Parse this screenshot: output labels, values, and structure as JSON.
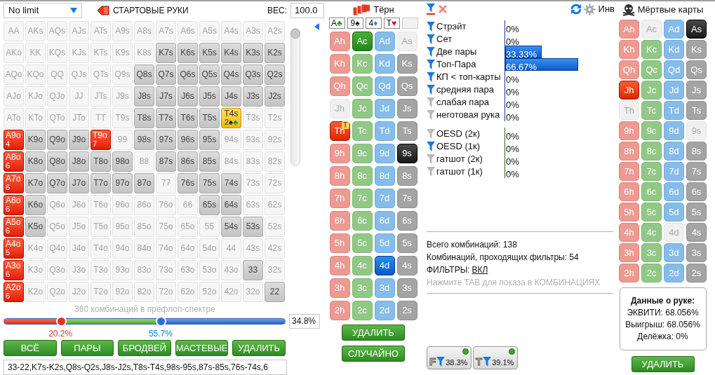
{
  "header": {
    "game_select": "No limit",
    "title": "СТАРТОВЫЕ РУКИ",
    "weight_label": "ВЕС:",
    "weight_value": "100.0"
  },
  "grid": [
    [
      {
        "hand": "AA",
        "kind": "off"
      },
      {
        "hand": "AKs",
        "kind": "off"
      },
      {
        "hand": "AQs",
        "kind": "off"
      },
      {
        "hand": "AJs",
        "kind": "off"
      },
      {
        "hand": "ATs",
        "kind": "off"
      },
      {
        "hand": "A9s",
        "kind": "off"
      },
      {
        "hand": "A8s",
        "kind": "off"
      },
      {
        "hand": "A7s",
        "kind": "off"
      },
      {
        "hand": "A6s",
        "kind": "off"
      },
      {
        "hand": "A5s",
        "kind": "off"
      },
      {
        "hand": "A4s",
        "kind": "off"
      },
      {
        "hand": "A3s",
        "kind": "off"
      },
      {
        "hand": "A2s",
        "kind": "off"
      }
    ],
    [
      {
        "hand": "AKo",
        "kind": "off"
      },
      {
        "hand": "KK",
        "kind": "off"
      },
      {
        "hand": "KQs",
        "kind": "off"
      },
      {
        "hand": "KJs",
        "kind": "off"
      },
      {
        "hand": "KTs",
        "kind": "off"
      },
      {
        "hand": "K9s",
        "kind": "off"
      },
      {
        "hand": "K8s",
        "kind": "off"
      },
      {
        "hand": "K7s",
        "kind": "range"
      },
      {
        "hand": "K6s",
        "kind": "range"
      },
      {
        "hand": "K5s",
        "kind": "range"
      },
      {
        "hand": "K4s",
        "kind": "range"
      },
      {
        "hand": "K3s",
        "kind": "range"
      },
      {
        "hand": "K2s",
        "kind": "range"
      }
    ],
    [
      {
        "hand": "AQo",
        "kind": "off"
      },
      {
        "hand": "KQo",
        "kind": "off"
      },
      {
        "hand": "QQ",
        "kind": "off"
      },
      {
        "hand": "QJs",
        "kind": "off"
      },
      {
        "hand": "QTs",
        "kind": "off"
      },
      {
        "hand": "Q9s",
        "kind": "off"
      },
      {
        "hand": "Q8s",
        "kind": "range"
      },
      {
        "hand": "Q7s",
        "kind": "range"
      },
      {
        "hand": "Q6s",
        "kind": "range"
      },
      {
        "hand": "Q5s",
        "kind": "range"
      },
      {
        "hand": "Q4s",
        "kind": "range"
      },
      {
        "hand": "Q3s",
        "kind": "range"
      },
      {
        "hand": "Q2s",
        "kind": "range"
      }
    ],
    [
      {
        "hand": "AJo",
        "kind": "off"
      },
      {
        "hand": "KJo",
        "kind": "off"
      },
      {
        "hand": "QJo",
        "kind": "off"
      },
      {
        "hand": "JJ",
        "kind": "off"
      },
      {
        "hand": "JTs",
        "kind": "off"
      },
      {
        "hand": "J9s",
        "kind": "off"
      },
      {
        "hand": "J8s",
        "kind": "range"
      },
      {
        "hand": "J7s",
        "kind": "range"
      },
      {
        "hand": "J6s",
        "kind": "range"
      },
      {
        "hand": "J5s",
        "kind": "range"
      },
      {
        "hand": "J4s",
        "kind": "range"
      },
      {
        "hand": "J3s",
        "kind": "range"
      },
      {
        "hand": "J2s",
        "kind": "range"
      }
    ],
    [
      {
        "hand": "ATo",
        "kind": "off"
      },
      {
        "hand": "KTo",
        "kind": "off"
      },
      {
        "hand": "QTo",
        "kind": "off"
      },
      {
        "hand": "JTo",
        "kind": "off"
      },
      {
        "hand": "TT",
        "kind": "off"
      },
      {
        "hand": "T9s",
        "kind": "off"
      },
      {
        "hand": "T8s",
        "kind": "range"
      },
      {
        "hand": "T7s",
        "kind": "range"
      },
      {
        "hand": "T6s",
        "kind": "range"
      },
      {
        "hand": "T5s",
        "kind": "range"
      },
      {
        "hand": "T4s",
        "kind": "highlight",
        "count": "2",
        "suits": [
          {
            "symbol": "♠",
            "color": "#111111"
          },
          {
            "symbol": "♣",
            "color": "#2e9a22"
          }
        ]
      },
      {
        "hand": "T3s",
        "kind": "off"
      },
      {
        "hand": "T2s",
        "kind": "off"
      }
    ],
    [
      {
        "hand": "A9o",
        "kind": "weighted",
        "count": "4"
      },
      {
        "hand": "K9o",
        "kind": "range"
      },
      {
        "hand": "Q9o",
        "kind": "range"
      },
      {
        "hand": "J9o",
        "kind": "range"
      },
      {
        "hand": "T9o",
        "kind": "weighted",
        "count": "7"
      },
      {
        "hand": "99",
        "kind": "off"
      },
      {
        "hand": "98s",
        "kind": "range"
      },
      {
        "hand": "97s",
        "kind": "range"
      },
      {
        "hand": "96s",
        "kind": "range"
      },
      {
        "hand": "95s",
        "kind": "range"
      },
      {
        "hand": "94s",
        "kind": "off"
      },
      {
        "hand": "93s",
        "kind": "off"
      },
      {
        "hand": "92s",
        "kind": "off"
      }
    ],
    [
      {
        "hand": "A8o",
        "kind": "weighted",
        "count": "6"
      },
      {
        "hand": "K8o",
        "kind": "range"
      },
      {
        "hand": "Q8o",
        "kind": "range"
      },
      {
        "hand": "J8o",
        "kind": "range"
      },
      {
        "hand": "T8o",
        "kind": "range"
      },
      {
        "hand": "98o",
        "kind": "range"
      },
      {
        "hand": "88",
        "kind": "off"
      },
      {
        "hand": "87s",
        "kind": "range"
      },
      {
        "hand": "86s",
        "kind": "range"
      },
      {
        "hand": "85s",
        "kind": "range"
      },
      {
        "hand": "84s",
        "kind": "off"
      },
      {
        "hand": "83s",
        "kind": "off"
      },
      {
        "hand": "82s",
        "kind": "off"
      }
    ],
    [
      {
        "hand": "A7o",
        "kind": "weighted",
        "count": "6"
      },
      {
        "hand": "K7o",
        "kind": "range"
      },
      {
        "hand": "Q7o",
        "kind": "range"
      },
      {
        "hand": "J7o",
        "kind": "range"
      },
      {
        "hand": "T7o",
        "kind": "range"
      },
      {
        "hand": "97o",
        "kind": "range"
      },
      {
        "hand": "87o",
        "kind": "range"
      },
      {
        "hand": "77",
        "kind": "off"
      },
      {
        "hand": "76s",
        "kind": "range"
      },
      {
        "hand": "75s",
        "kind": "range"
      },
      {
        "hand": "74s",
        "kind": "range"
      },
      {
        "hand": "73s",
        "kind": "off"
      },
      {
        "hand": "72s",
        "kind": "off"
      }
    ],
    [
      {
        "hand": "A6o",
        "kind": "weighted",
        "count": "6"
      },
      {
        "hand": "K6o",
        "kind": "range"
      },
      {
        "hand": "Q6o",
        "kind": "off"
      },
      {
        "hand": "J6o",
        "kind": "off"
      },
      {
        "hand": "T6o",
        "kind": "off"
      },
      {
        "hand": "96o",
        "kind": "off"
      },
      {
        "hand": "86o",
        "kind": "off"
      },
      {
        "hand": "76o",
        "kind": "off"
      },
      {
        "hand": "66",
        "kind": "off"
      },
      {
        "hand": "65s",
        "kind": "range"
      },
      {
        "hand": "64s",
        "kind": "range"
      },
      {
        "hand": "63s",
        "kind": "off"
      },
      {
        "hand": "62s",
        "kind": "off"
      }
    ],
    [
      {
        "hand": "A5o",
        "kind": "weighted",
        "count": "6"
      },
      {
        "hand": "K5o",
        "kind": "range"
      },
      {
        "hand": "Q5o",
        "kind": "off"
      },
      {
        "hand": "J5o",
        "kind": "off"
      },
      {
        "hand": "T5o",
        "kind": "off"
      },
      {
        "hand": "95o",
        "kind": "off"
      },
      {
        "hand": "85o",
        "kind": "off"
      },
      {
        "hand": "75o",
        "kind": "off"
      },
      {
        "hand": "65o",
        "kind": "off"
      },
      {
        "hand": "55",
        "kind": "off"
      },
      {
        "hand": "54s",
        "kind": "range"
      },
      {
        "hand": "53s",
        "kind": "range"
      },
      {
        "hand": "52s",
        "kind": "off"
      }
    ],
    [
      {
        "hand": "A4o",
        "kind": "weighted",
        "count": "5"
      },
      {
        "hand": "K4o",
        "kind": "off"
      },
      {
        "hand": "Q4o",
        "kind": "off"
      },
      {
        "hand": "J4o",
        "kind": "off"
      },
      {
        "hand": "T4o",
        "kind": "off"
      },
      {
        "hand": "94o",
        "kind": "off"
      },
      {
        "hand": "84o",
        "kind": "off"
      },
      {
        "hand": "74o",
        "kind": "off"
      },
      {
        "hand": "64o",
        "kind": "off"
      },
      {
        "hand": "54o",
        "kind": "off"
      },
      {
        "hand": "44",
        "kind": "off"
      },
      {
        "hand": "43s",
        "kind": "off"
      },
      {
        "hand": "42s",
        "kind": "off"
      }
    ],
    [
      {
        "hand": "A3o",
        "kind": "weighted",
        "count": "6"
      },
      {
        "hand": "K3o",
        "kind": "off"
      },
      {
        "hand": "Q3o",
        "kind": "off"
      },
      {
        "hand": "J3o",
        "kind": "off"
      },
      {
        "hand": "T3o",
        "kind": "off"
      },
      {
        "hand": "93o",
        "kind": "off"
      },
      {
        "hand": "83o",
        "kind": "off"
      },
      {
        "hand": "73o",
        "kind": "off"
      },
      {
        "hand": "63o",
        "kind": "off"
      },
      {
        "hand": "53o",
        "kind": "off"
      },
      {
        "hand": "43o",
        "kind": "off"
      },
      {
        "hand": "33",
        "kind": "range"
      },
      {
        "hand": "32s",
        "kind": "off"
      }
    ],
    [
      {
        "hand": "A2o",
        "kind": "weighted",
        "count": "6"
      },
      {
        "hand": "K2o",
        "kind": "off"
      },
      {
        "hand": "Q2o",
        "kind": "off"
      },
      {
        "hand": "J2o",
        "kind": "off"
      },
      {
        "hand": "T2o",
        "kind": "off"
      },
      {
        "hand": "92o",
        "kind": "off"
      },
      {
        "hand": "82o",
        "kind": "off"
      },
      {
        "hand": "72o",
        "kind": "off"
      },
      {
        "hand": "62o",
        "kind": "off"
      },
      {
        "hand": "52o",
        "kind": "off"
      },
      {
        "hand": "42o",
        "kind": "off"
      },
      {
        "hand": "32o",
        "kind": "off"
      },
      {
        "hand": "22",
        "kind": "range"
      }
    ]
  ],
  "weight_slider": {
    "level": 1
  },
  "range_slider": {
    "caption": "360 комбинаций в префлоп-спектре",
    "low": {
      "level": 0.202,
      "label": "20.2%"
    },
    "high": {
      "level": 0.557,
      "label": "55.7%"
    },
    "value": "34.8%"
  },
  "range_buttons": [
    "ВСЁ",
    "ПАРЫ",
    "БРОДВЕЙ",
    "МАСТЕВЫЕ",
    "УДАЛИТЬ"
  ],
  "range_text": "33-22,K7s-K2s,Q8s-Q2s,J8s-J2s,T8s-T4s,98s-95s,87s-85s,76s-74s,6",
  "turn": {
    "title": "Тёрн",
    "board": [
      {
        "kind": "card",
        "rank": "A",
        "suit": "♣",
        "color": "#2e9a22"
      },
      {
        "kind": "card",
        "rank": "9",
        "suit": "♠",
        "color": "#111111"
      },
      {
        "kind": "card",
        "rank": "4",
        "suit": "♦",
        "color": "#1e90e8"
      },
      {
        "kind": "card",
        "rank": "T",
        "suit": "♥",
        "color": "#e01010"
      },
      {
        "kind": "empty"
      }
    ],
    "cards": [
      [
        {
          "label": "Ah",
          "selected": false,
          "dead": false
        },
        {
          "label": "Ac",
          "selected": true,
          "dead": false
        },
        {
          "label": "Ad",
          "selected": false,
          "dead": false
        },
        {
          "label": "As",
          "selected": false,
          "dead": true
        }
      ],
      [
        {
          "label": "Kh",
          "selected": false,
          "dead": false
        },
        {
          "label": "Kc",
          "selected": false,
          "dead": false
        },
        {
          "label": "Kd",
          "selected": false,
          "dead": false
        },
        {
          "label": "Ks",
          "selected": false,
          "dead": false
        }
      ],
      [
        {
          "label": "Qh",
          "selected": false,
          "dead": false
        },
        {
          "label": "Qc",
          "selected": false,
          "dead": false
        },
        {
          "label": "Qd",
          "selected": false,
          "dead": false
        },
        {
          "label": "Qs",
          "selected": false,
          "dead": false
        }
      ],
      [
        {
          "label": "Jh",
          "selected": false,
          "dead": true
        },
        {
          "label": "Jc",
          "selected": false,
          "dead": false
        },
        {
          "label": "Jd",
          "selected": false,
          "dead": false
        },
        {
          "label": "Js",
          "selected": false,
          "dead": false
        }
      ],
      [
        {
          "label": "Th",
          "selected": true,
          "dead": false,
          "badge": "T"
        },
        {
          "label": "Tc",
          "selected": false,
          "dead": false
        },
        {
          "label": "Td",
          "selected": false,
          "dead": false
        },
        {
          "label": "Ts",
          "selected": false,
          "dead": false
        }
      ],
      [
        {
          "label": "9h",
          "selected": false,
          "dead": false
        },
        {
          "label": "9c",
          "selected": false,
          "dead": false
        },
        {
          "label": "9d",
          "selected": false,
          "dead": false
        },
        {
          "label": "9s",
          "selected": true,
          "dead": false
        }
      ],
      [
        {
          "label": "8h",
          "selected": false,
          "dead": false
        },
        {
          "label": "8c",
          "selected": false,
          "dead": false
        },
        {
          "label": "8d",
          "selected": false,
          "dead": false
        },
        {
          "label": "8s",
          "selected": false,
          "dead": false
        }
      ],
      [
        {
          "label": "7h",
          "selected": false,
          "dead": false
        },
        {
          "label": "7c",
          "selected": false,
          "dead": false
        },
        {
          "label": "7d",
          "selected": false,
          "dead": false
        },
        {
          "label": "7s",
          "selected": false,
          "dead": false
        }
      ],
      [
        {
          "label": "6h",
          "selected": false,
          "dead": false
        },
        {
          "label": "6c",
          "selected": false,
          "dead": false
        },
        {
          "label": "6d",
          "selected": false,
          "dead": false
        },
        {
          "label": "6s",
          "selected": false,
          "dead": false
        }
      ],
      [
        {
          "label": "5h",
          "selected": false,
          "dead": false
        },
        {
          "label": "5c",
          "selected": false,
          "dead": false
        },
        {
          "label": "5d",
          "selected": false,
          "dead": false
        },
        {
          "label": "5s",
          "selected": false,
          "dead": false
        }
      ],
      [
        {
          "label": "4h",
          "selected": false,
          "dead": false
        },
        {
          "label": "4c",
          "selected": false,
          "dead": false
        },
        {
          "label": "4d",
          "selected": true,
          "dead": false
        },
        {
          "label": "4s",
          "selected": false,
          "dead": false
        }
      ],
      [
        {
          "label": "3h",
          "selected": false,
          "dead": false
        },
        {
          "label": "3c",
          "selected": false,
          "dead": false
        },
        {
          "label": "3d",
          "selected": false,
          "dead": false
        },
        {
          "label": "3s",
          "selected": false,
          "dead": false
        }
      ],
      [
        {
          "label": "2h",
          "selected": false,
          "dead": false
        },
        {
          "label": "2c",
          "selected": false,
          "dead": false
        },
        {
          "label": "2d",
          "selected": false,
          "dead": false
        },
        {
          "label": "2s",
          "selected": false,
          "dead": false
        }
      ]
    ],
    "buttons": [
      "УДАЛИТЬ",
      "СЛУЧАЙНО"
    ]
  },
  "filters": {
    "invert_label": "Инв",
    "groups": [
      {
        "kind": "made",
        "items": [
          {
            "label": "Стрэйт",
            "on": true,
            "value": "0%"
          },
          {
            "label": "Сет",
            "on": true,
            "value": "0%"
          },
          {
            "label": "Две пары",
            "on": true,
            "value": "33.33%",
            "level": 0.3333
          },
          {
            "label": "Топ-Пара",
            "on": true,
            "value": "66.67%",
            "level": 0.6667
          },
          {
            "label": "КП < топ-карты",
            "on": true,
            "value": "0%"
          },
          {
            "label": "средняя пара",
            "on": true,
            "value": "0%"
          },
          {
            "label": "слабая пара",
            "on": false,
            "value": "0%"
          },
          {
            "label": "неготовая рука",
            "on": false,
            "value": "0%"
          }
        ]
      },
      {
        "kind": "draw",
        "items": [
          {
            "label": "OESD (2к)",
            "on": false,
            "value": "0%"
          },
          {
            "label": "OESD (1к)",
            "on": true,
            "value": "0%"
          },
          {
            "label": "гатшот (2к)",
            "on": false,
            "value": "0%"
          },
          {
            "label": "гатшот (1к)",
            "on": false,
            "value": "0%"
          }
        ]
      }
    ],
    "stats": [
      "Всего комбинаций: 138",
      "Комбинаций, проходящих фильтры: 54"
    ],
    "filters_state": {
      "label": "ФИЛЬТРЫ:",
      "link": "ВКЛ"
    },
    "hint": "Нажмите TAB для показа в КОМБИНАЦИЯХ",
    "toggles": [
      {
        "letter": "F",
        "value": "38.3%",
        "on": true
      },
      {
        "letter": "T",
        "value": "39.1%",
        "on": true
      }
    ]
  },
  "dead": {
    "title": "Мёртвые карты",
    "cards": [
      [
        {
          "label": "Ah",
          "selected": false,
          "dead": false
        },
        {
          "label": "Ac",
          "selected": false,
          "dead": true
        },
        {
          "label": "Ad",
          "selected": false,
          "dead": false
        },
        {
          "label": "As",
          "selected": true,
          "dead": false
        }
      ],
      [
        {
          "label": "Kh",
          "selected": false,
          "dead": false
        },
        {
          "label": "Kc",
          "selected": false,
          "dead": false
        },
        {
          "label": "Kd",
          "selected": false,
          "dead": false
        },
        {
          "label": "Ks",
          "selected": false,
          "dead": false
        }
      ],
      [
        {
          "label": "Qh",
          "selected": false,
          "dead": false
        },
        {
          "label": "Qc",
          "selected": false,
          "dead": false
        },
        {
          "label": "Qd",
          "selected": false,
          "dead": false
        },
        {
          "label": "Qs",
          "selected": false,
          "dead": false
        }
      ],
      [
        {
          "label": "Jh",
          "selected": true,
          "dead": false
        },
        {
          "label": "Jc",
          "selected": false,
          "dead": false
        },
        {
          "label": "Jd",
          "selected": false,
          "dead": false
        },
        {
          "label": "Js",
          "selected": false,
          "dead": false
        }
      ],
      [
        {
          "label": "Th",
          "selected": false,
          "dead": true
        },
        {
          "label": "Tc",
          "selected": false,
          "dead": false
        },
        {
          "label": "Td",
          "selected": false,
          "dead": false
        },
        {
          "label": "Ts",
          "selected": false,
          "dead": false
        }
      ],
      [
        {
          "label": "9h",
          "selected": false,
          "dead": false
        },
        {
          "label": "9c",
          "selected": false,
          "dead": false
        },
        {
          "label": "9d",
          "selected": false,
          "dead": false
        },
        {
          "label": "9s",
          "selected": false,
          "dead": true
        }
      ],
      [
        {
          "label": "8h",
          "selected": false,
          "dead": false
        },
        {
          "label": "8c",
          "selected": false,
          "dead": false
        },
        {
          "label": "8d",
          "selected": false,
          "dead": false
        },
        {
          "label": "8s",
          "selected": false,
          "dead": false
        }
      ],
      [
        {
          "label": "7h",
          "selected": false,
          "dead": false
        },
        {
          "label": "7c",
          "selected": false,
          "dead": false
        },
        {
          "label": "7d",
          "selected": false,
          "dead": false
        },
        {
          "label": "7s",
          "selected": false,
          "dead": false
        }
      ],
      [
        {
          "label": "6h",
          "selected": false,
          "dead": false
        },
        {
          "label": "6c",
          "selected": false,
          "dead": false
        },
        {
          "label": "6d",
          "selected": false,
          "dead": false
        },
        {
          "label": "6s",
          "selected": false,
          "dead": false
        }
      ],
      [
        {
          "label": "5h",
          "selected": false,
          "dead": false
        },
        {
          "label": "5c",
          "selected": false,
          "dead": false
        },
        {
          "label": "5d",
          "selected": false,
          "dead": false
        },
        {
          "label": "5s",
          "selected": false,
          "dead": false
        }
      ],
      [
        {
          "label": "4h",
          "selected": false,
          "dead": false
        },
        {
          "label": "4c",
          "selected": false,
          "dead": false
        },
        {
          "label": "4d",
          "selected": false,
          "dead": true
        },
        {
          "label": "4s",
          "selected": false,
          "dead": false
        }
      ],
      [
        {
          "label": "3h",
          "selected": false,
          "dead": false
        },
        {
          "label": "3c",
          "selected": false,
          "dead": false
        },
        {
          "label": "3d",
          "selected": false,
          "dead": false
        },
        {
          "label": "3s",
          "selected": false,
          "dead": false
        }
      ],
      [
        {
          "label": "2h",
          "selected": false,
          "dead": false
        },
        {
          "label": "2c",
          "selected": false,
          "dead": false
        },
        {
          "label": "2d",
          "selected": false,
          "dead": false
        },
        {
          "label": "2s",
          "selected": false,
          "dead": false
        }
      ]
    ],
    "hand_data": {
      "title": "Данные о руке:",
      "lines": [
        "ЭКВИТИ: 68.056%",
        "Выигрыш: 68.056%",
        "Делёжка: 0%"
      ]
    },
    "button": "УДАЛИТЬ"
  }
}
